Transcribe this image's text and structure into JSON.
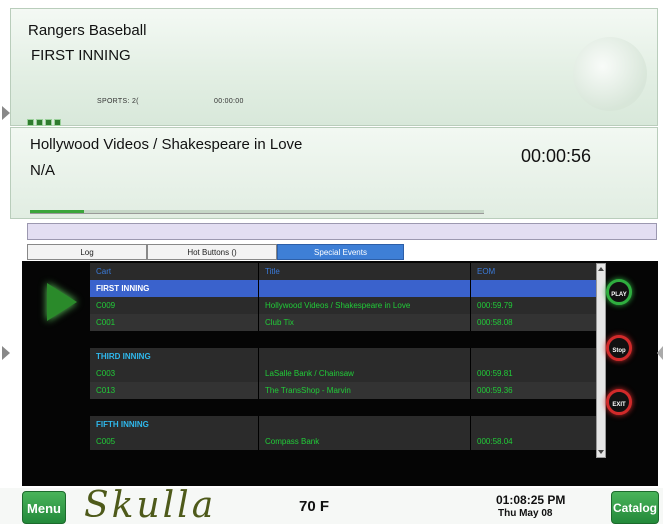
{
  "now_playing": {
    "title": "Rangers Baseball",
    "subtitle": "FIRST INNING",
    "category": "SPORTS: 2(",
    "timer": "00:00:00",
    "icon": "satellite-dish-icon"
  },
  "up_next": {
    "title": "Hollywood Videos / Shakespeare in Love",
    "subtitle": "N/A",
    "time": "00:00:56",
    "progress": 0.12
  },
  "tabs": [
    {
      "label": "Log"
    },
    {
      "label": "Hot Buttons ()"
    },
    {
      "label": "Special Events"
    }
  ],
  "active_tab": "Special Events",
  "table": {
    "columns": [
      "Cart",
      "Title",
      "EOM"
    ],
    "sections": [
      {
        "name": "FIRST INNING",
        "rows": [
          {
            "cart": "C009",
            "title": "Hollywood Videos / Shakespeare in Love",
            "eom": "000:59.79"
          },
          {
            "cart": "C001",
            "title": "Club Tix",
            "eom": "000:58.08"
          }
        ]
      },
      {
        "name": "THIRD INNING",
        "rows": [
          {
            "cart": "C003",
            "title": "LaSalle Bank / Chainsaw",
            "eom": "000:59.81"
          },
          {
            "cart": "C013",
            "title": "The TransShop - Marvin",
            "eom": "000:59.36"
          }
        ]
      },
      {
        "name": "FIFTH INNING",
        "rows": [
          {
            "cart": "C005",
            "title": "Compass Bank",
            "eom": "000:58.04"
          }
        ]
      }
    ]
  },
  "controls": {
    "play": "PLAY",
    "stop": "Stop",
    "exit": "EXIT"
  },
  "footer": {
    "menu": "Menu",
    "logo": "Skulla",
    "temperature": "70 F",
    "clock": "01:08:25 PM",
    "date": "Thu May 08",
    "catalog": "Catalog"
  },
  "colors": {
    "accent_green": "#2fae3f",
    "accent_red": "#d12a2a",
    "selected_row": "#3a62cc",
    "item_text": "#21cc38",
    "section_text": "#2fb8ec"
  }
}
